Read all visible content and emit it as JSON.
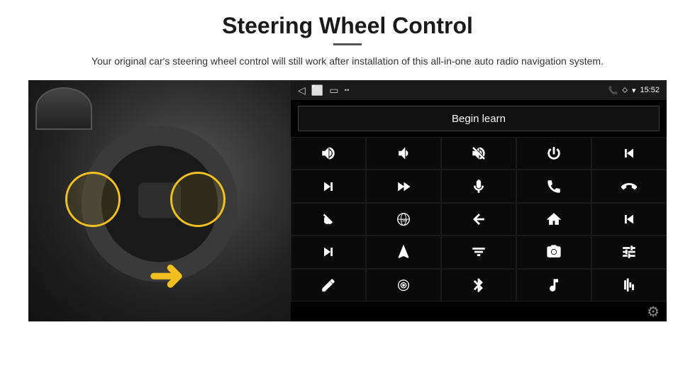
{
  "header": {
    "title": "Steering Wheel Control",
    "subtitle": "Your original car's steering wheel control will still work after installation of this all-in-one auto radio navigation system."
  },
  "status_bar": {
    "time": "15:52",
    "back_icon": "◁",
    "home_icon": "□",
    "square_icon": "⬜",
    "signal_icon": "▪▪",
    "phone_icon": "📞",
    "location_icon": "⬦",
    "wifi_icon": "▾"
  },
  "begin_learn": {
    "label": "Begin learn"
  },
  "icons": [
    {
      "name": "volume-up",
      "symbol": "🔊+",
      "unicode": "vol+"
    },
    {
      "name": "volume-down",
      "symbol": "🔉-",
      "unicode": "vol-"
    },
    {
      "name": "mute",
      "symbol": "🔇",
      "unicode": "mute"
    },
    {
      "name": "power",
      "symbol": "⏻",
      "unicode": "pwr"
    },
    {
      "name": "prev-track",
      "symbol": "⏮",
      "unicode": "prev"
    },
    {
      "name": "next-track",
      "symbol": "⏭",
      "unicode": "next"
    },
    {
      "name": "fast-forward",
      "symbol": "⏩",
      "unicode": "ff"
    },
    {
      "name": "microphone",
      "symbol": "🎤",
      "unicode": "mic"
    },
    {
      "name": "phone",
      "symbol": "📞",
      "unicode": "call"
    },
    {
      "name": "hang-up",
      "symbol": "📵",
      "unicode": "end"
    },
    {
      "name": "mute-car",
      "symbol": "🔕",
      "unicode": "mcar"
    },
    {
      "name": "360-view",
      "symbol": "👁",
      "unicode": "360"
    },
    {
      "name": "back",
      "symbol": "↩",
      "unicode": "back"
    },
    {
      "name": "home",
      "symbol": "⌂",
      "unicode": "home"
    },
    {
      "name": "rewind",
      "symbol": "⏮",
      "unicode": "rew"
    },
    {
      "name": "skip-forward",
      "symbol": "⏭",
      "unicode": "skip"
    },
    {
      "name": "navigation",
      "symbol": "➤",
      "unicode": "nav"
    },
    {
      "name": "equalizer",
      "symbol": "⇄",
      "unicode": "eq"
    },
    {
      "name": "camera",
      "symbol": "📷",
      "unicode": "cam"
    },
    {
      "name": "settings-sliders",
      "symbol": "⚙",
      "unicode": "sl"
    },
    {
      "name": "pen",
      "symbol": "✏",
      "unicode": "pen"
    },
    {
      "name": "radio",
      "symbol": "◎",
      "unicode": "rad"
    },
    {
      "name": "bluetooth",
      "symbol": "⚡",
      "unicode": "bt"
    },
    {
      "name": "music",
      "symbol": "♪",
      "unicode": "mus"
    },
    {
      "name": "equalizer-bars",
      "symbol": "|||",
      "unicode": "eq2"
    }
  ],
  "settings": {
    "gear_label": "⚙"
  }
}
